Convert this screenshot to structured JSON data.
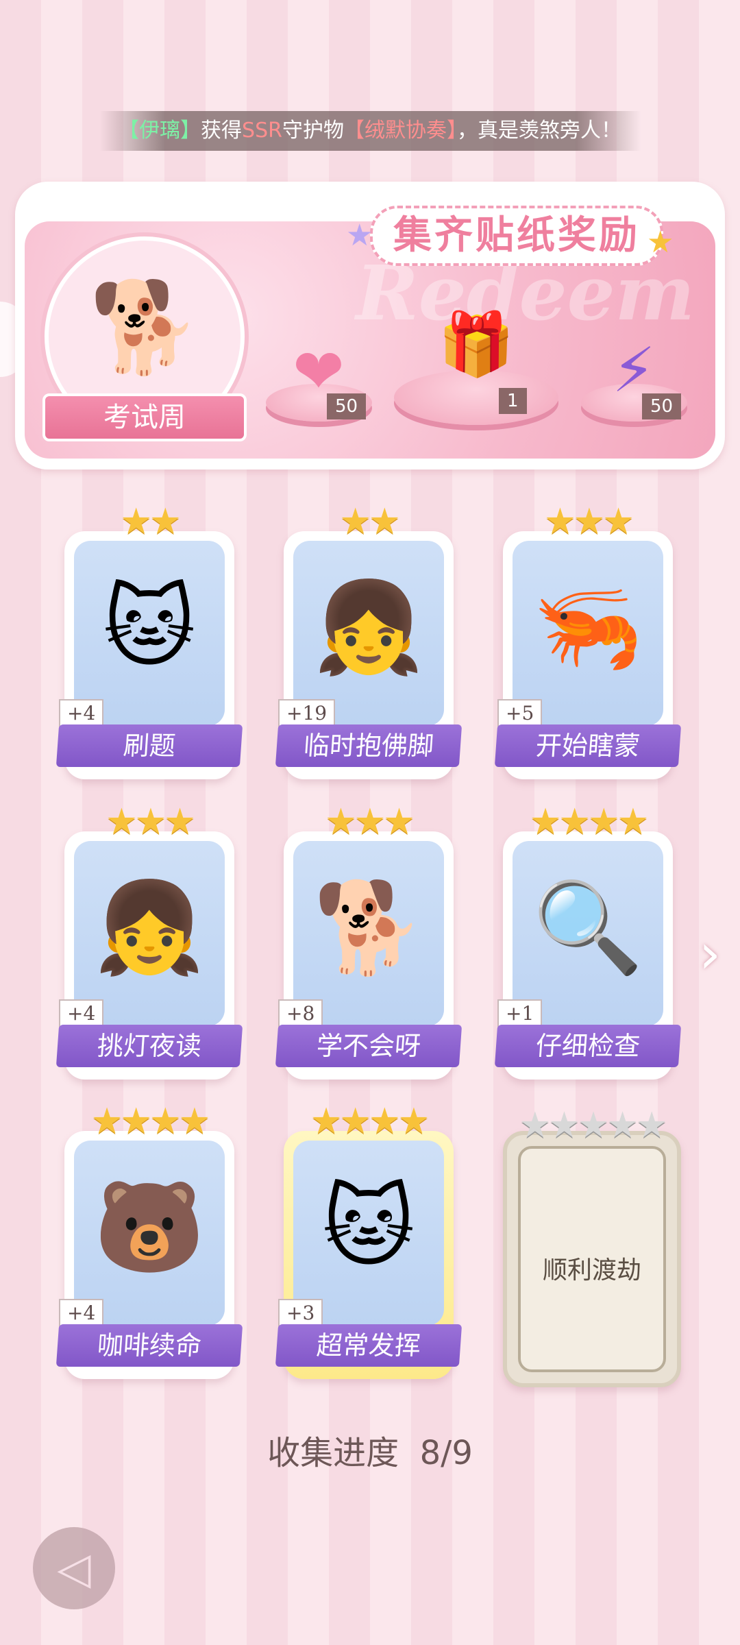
{
  "ticker": {
    "name": "【伊璃】",
    "verb": "获得",
    "rarity": "SSR",
    "item_word": "守护物",
    "item": "【绒默协奏】",
    "tail": "，真是羡煞旁人！"
  },
  "banner": {
    "title": "集齐贴纸奖励",
    "watermark": "Redeem",
    "theme_label": "考试周",
    "rewards": [
      {
        "icon": "pink-heart-gem-icon",
        "count": "50"
      },
      {
        "icon": "gift-box-icon",
        "count": "1"
      },
      {
        "icon": "purple-lightning-orb-icon",
        "count": "50"
      }
    ]
  },
  "cards": [
    {
      "label": "刷题",
      "bonus": "+4",
      "stars": 2,
      "icon": "cat-studying-icon"
    },
    {
      "label": "临时抱佛脚",
      "bonus": "+19",
      "stars": 2,
      "icon": "girl-reading-icon"
    },
    {
      "label": "开始瞎蒙",
      "bonus": "+5",
      "stars": 3,
      "icon": "shrimp-sign-icon"
    },
    {
      "label": "挑灯夜读",
      "bonus": "+4",
      "stars": 3,
      "icon": "girl-desk-lamp-icon"
    },
    {
      "label": "学不会呀",
      "bonus": "+8",
      "stars": 3,
      "icon": "shiba-lying-icon"
    },
    {
      "label": "仔细检查",
      "bonus": "+1",
      "stars": 4,
      "icon": "girl-magnifier-icon"
    },
    {
      "label": "咖啡续命",
      "bonus": "+4",
      "stars": 4,
      "icon": "bear-coffee-icon"
    },
    {
      "label": "超常发挥",
      "bonus": "+3",
      "stars": 4,
      "icon": "cat-pencils-icon"
    },
    {
      "label": "顺利渡劫",
      "stars": 5,
      "locked": true
    }
  ],
  "progress": {
    "label": "收集进度",
    "value": "8/9"
  },
  "colors": {
    "accent_pink": "#ef7f9e",
    "label_purple": "#8257c8",
    "star_gold": "#f8c23a"
  }
}
